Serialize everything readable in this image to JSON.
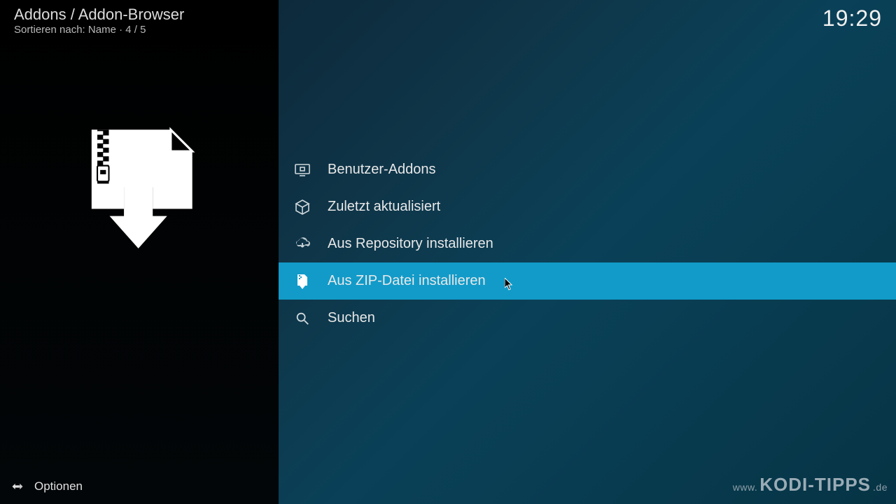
{
  "header": {
    "breadcrumb": "Addons / Addon-Browser",
    "sort_label": "Sortieren nach: Name  ·  4 / 5",
    "clock": "19:29"
  },
  "menu": {
    "items": [
      {
        "label": "Benutzer-Addons",
        "icon": "monitor-icon",
        "selected": false
      },
      {
        "label": "Zuletzt aktualisiert",
        "icon": "box-icon",
        "selected": false
      },
      {
        "label": "Aus Repository installieren",
        "icon": "cloud-download-icon",
        "selected": false
      },
      {
        "label": "Aus ZIP-Datei installieren",
        "icon": "zip-file-icon",
        "selected": true
      },
      {
        "label": "Suchen",
        "icon": "search-icon",
        "selected": false
      }
    ]
  },
  "footer": {
    "options_label": "Optionen"
  },
  "watermark": {
    "prefix": "www.",
    "brand": "KODI-TIPPS",
    "suffix": ".de"
  }
}
